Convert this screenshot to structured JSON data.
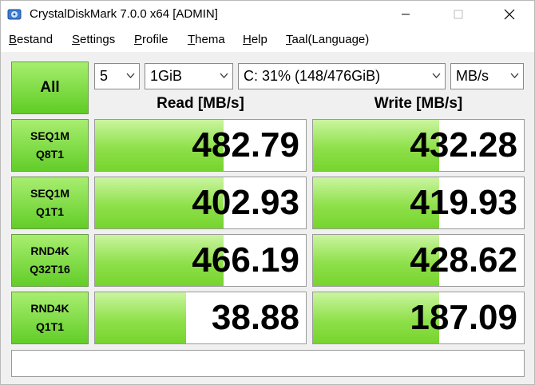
{
  "window": {
    "title": "CrystalDiskMark 7.0.0 x64 [ADMIN]"
  },
  "menu": [
    "Bestand",
    "Settings",
    "Profile",
    "Thema",
    "Help",
    "Taal(Language)"
  ],
  "controls": {
    "all_label": "All",
    "count": "5",
    "size": "1GiB",
    "drive": "C: 31% (148/476GiB)",
    "unit": "MB/s"
  },
  "headers": {
    "read": "Read [MB/s]",
    "write": "Write [MB/s]"
  },
  "rows": [
    {
      "line1": "SEQ1M",
      "line2": "Q8T1",
      "read": "482.79",
      "write": "432.28",
      "read_fill": 0.61,
      "write_fill": 0.6
    },
    {
      "line1": "SEQ1M",
      "line2": "Q1T1",
      "read": "402.93",
      "write": "419.93",
      "read_fill": 0.61,
      "write_fill": 0.6
    },
    {
      "line1": "RND4K",
      "line2": "Q32T16",
      "read": "466.19",
      "write": "428.62",
      "read_fill": 0.61,
      "write_fill": 0.6
    },
    {
      "line1": "RND4K",
      "line2": "Q1T1",
      "read": "38.88",
      "write": "187.09",
      "read_fill": 0.43,
      "write_fill": 0.6
    }
  ],
  "status": "",
  "colors": {
    "accent_green": "#76d42e",
    "button_green": "#62cd28"
  }
}
